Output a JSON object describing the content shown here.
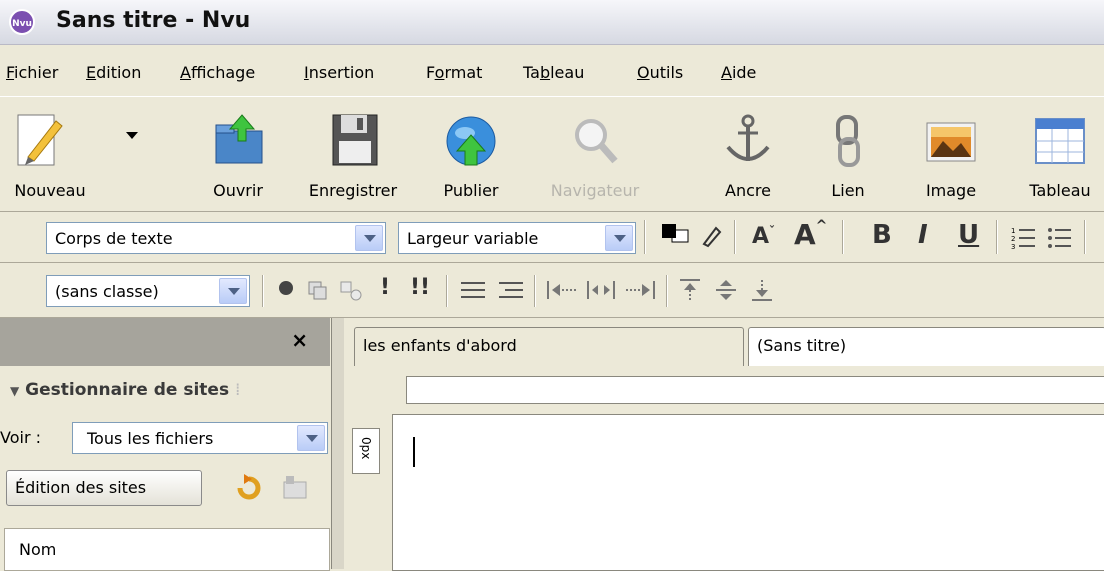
{
  "window": {
    "title": "Sans titre - Nvu",
    "icon": "nvu-logo-icon"
  },
  "menubar": [
    {
      "label": "Fichier",
      "u": "F",
      "rest": "ichier"
    },
    {
      "label": "Edition",
      "u": "E",
      "rest": "dition"
    },
    {
      "label": "Affichage",
      "u": "A",
      "rest": "ffichage"
    },
    {
      "label": "Insertion",
      "u": "I",
      "rest": "nsertion"
    },
    {
      "label": "Format",
      "pre": "F",
      "u": "o",
      "rest": "rmat"
    },
    {
      "label": "Tableau",
      "pre": "Ta",
      "u": "b",
      "rest": "leau"
    },
    {
      "label": "Outils",
      "u": "O",
      "rest": "utils"
    },
    {
      "label": "Aide",
      "u": "A",
      "rest": "ide"
    }
  ],
  "toolbar": {
    "nouveau": "Nouveau",
    "ouvrir": "Ouvrir",
    "enregistrer": "Enregistrer",
    "publier": "Publier",
    "navigateur": "Navigateur",
    "ancre": "Ancre",
    "lien": "Lien",
    "image": "Image",
    "tableau": "Tableau"
  },
  "format": {
    "paragraph_style": "Corps de texte",
    "font": "Largeur variable",
    "class": "(sans classe)",
    "bold": "B",
    "italic": "I",
    "underline": "U"
  },
  "sidebar": {
    "close": "×",
    "title": "Gestionnaire de sites",
    "filter_label": "Voir :",
    "filter_value": "Tous les fichiers",
    "edit_sites": "Édition des sites",
    "column_name": "Nom"
  },
  "editor": {
    "tabs": [
      "les enfants d'abord",
      "(Sans titre)"
    ],
    "ruler_unit": "0px"
  },
  "colors": {
    "accent": "#316ac5",
    "toolbar_bg": "#ece9d8"
  }
}
